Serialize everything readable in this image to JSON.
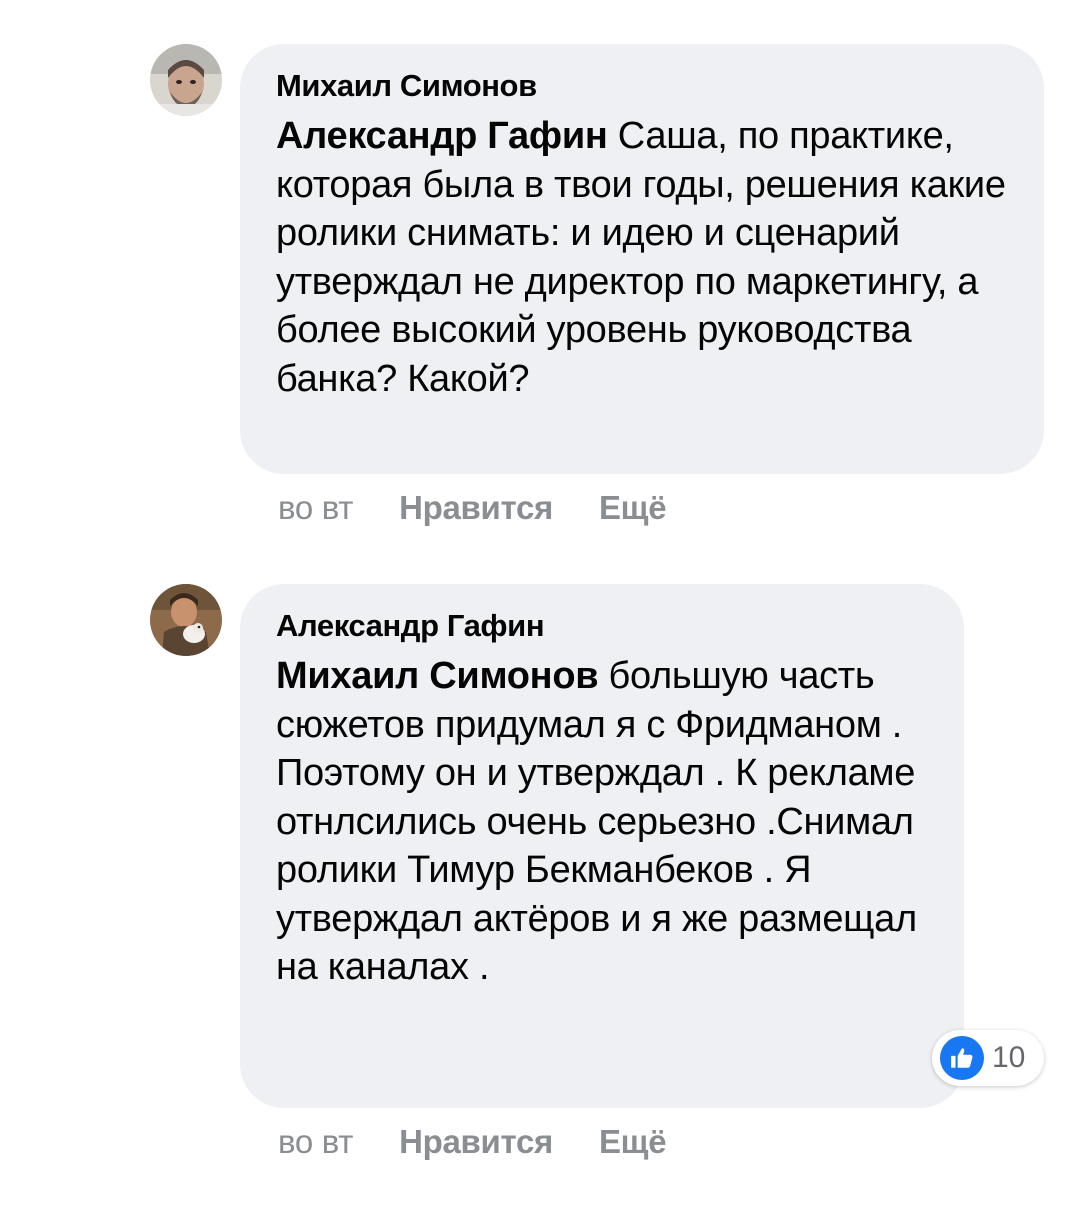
{
  "colors": {
    "bubble_bg": "#eef0f3",
    "meta_text": "#8a8d91",
    "like_blue": "#1877f2"
  },
  "comments": [
    {
      "author": "Михаил Симонов",
      "mention": "Александр Гафин",
      "body": " Саша, по практике, которая была в твои годы, решения какие ролики снимать: и идею и сценарий утверждал не директор по маркетингу, а более высокий уровень руководства банка? Какой?",
      "time": "во вт",
      "like_label": "Нравится",
      "more_label": "Ещё"
    },
    {
      "author": "Александр Гафин",
      "mention": "Михаил Симонов",
      "body": " большую часть сюжетов придумал я с Фридманом . Поэтому он и утверждал . К рекламе отнлсились очень серьезно .Снимал ролики Тимур Бекманбеков . Я утверждал актёров и я же размещал на каналах .",
      "time": "во вт",
      "like_label": "Нравится",
      "more_label": "Ещё",
      "reactions": {
        "icon": "like-icon",
        "count": "10"
      }
    }
  ]
}
